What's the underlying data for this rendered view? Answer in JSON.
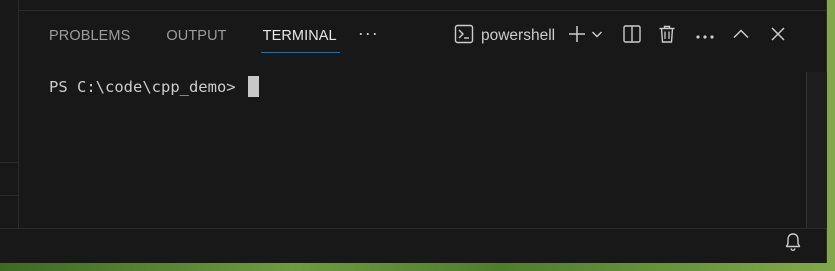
{
  "panel": {
    "tabs": [
      {
        "label": "PROBLEMS",
        "active": false
      },
      {
        "label": "OUTPUT",
        "active": false
      },
      {
        "label": "TERMINAL",
        "active": true
      }
    ],
    "more_tabs_label": "···"
  },
  "terminal_toolbar": {
    "profile_label": "powershell",
    "icons": [
      "terminal-icon",
      "plus-icon",
      "chevron-down-icon",
      "split-icon",
      "trash-icon",
      "more-icon",
      "chevron-up-icon",
      "close-icon"
    ]
  },
  "terminal": {
    "prompt": "PS C:\\code\\cpp_demo>"
  },
  "status_bar": {
    "icons": [
      "bell-icon"
    ]
  },
  "colors": {
    "panel_bg": "#181818",
    "active_tab_underline": "#0078d4",
    "text": "#cccccc",
    "inactive_tab_text": "#9d9d9d"
  }
}
